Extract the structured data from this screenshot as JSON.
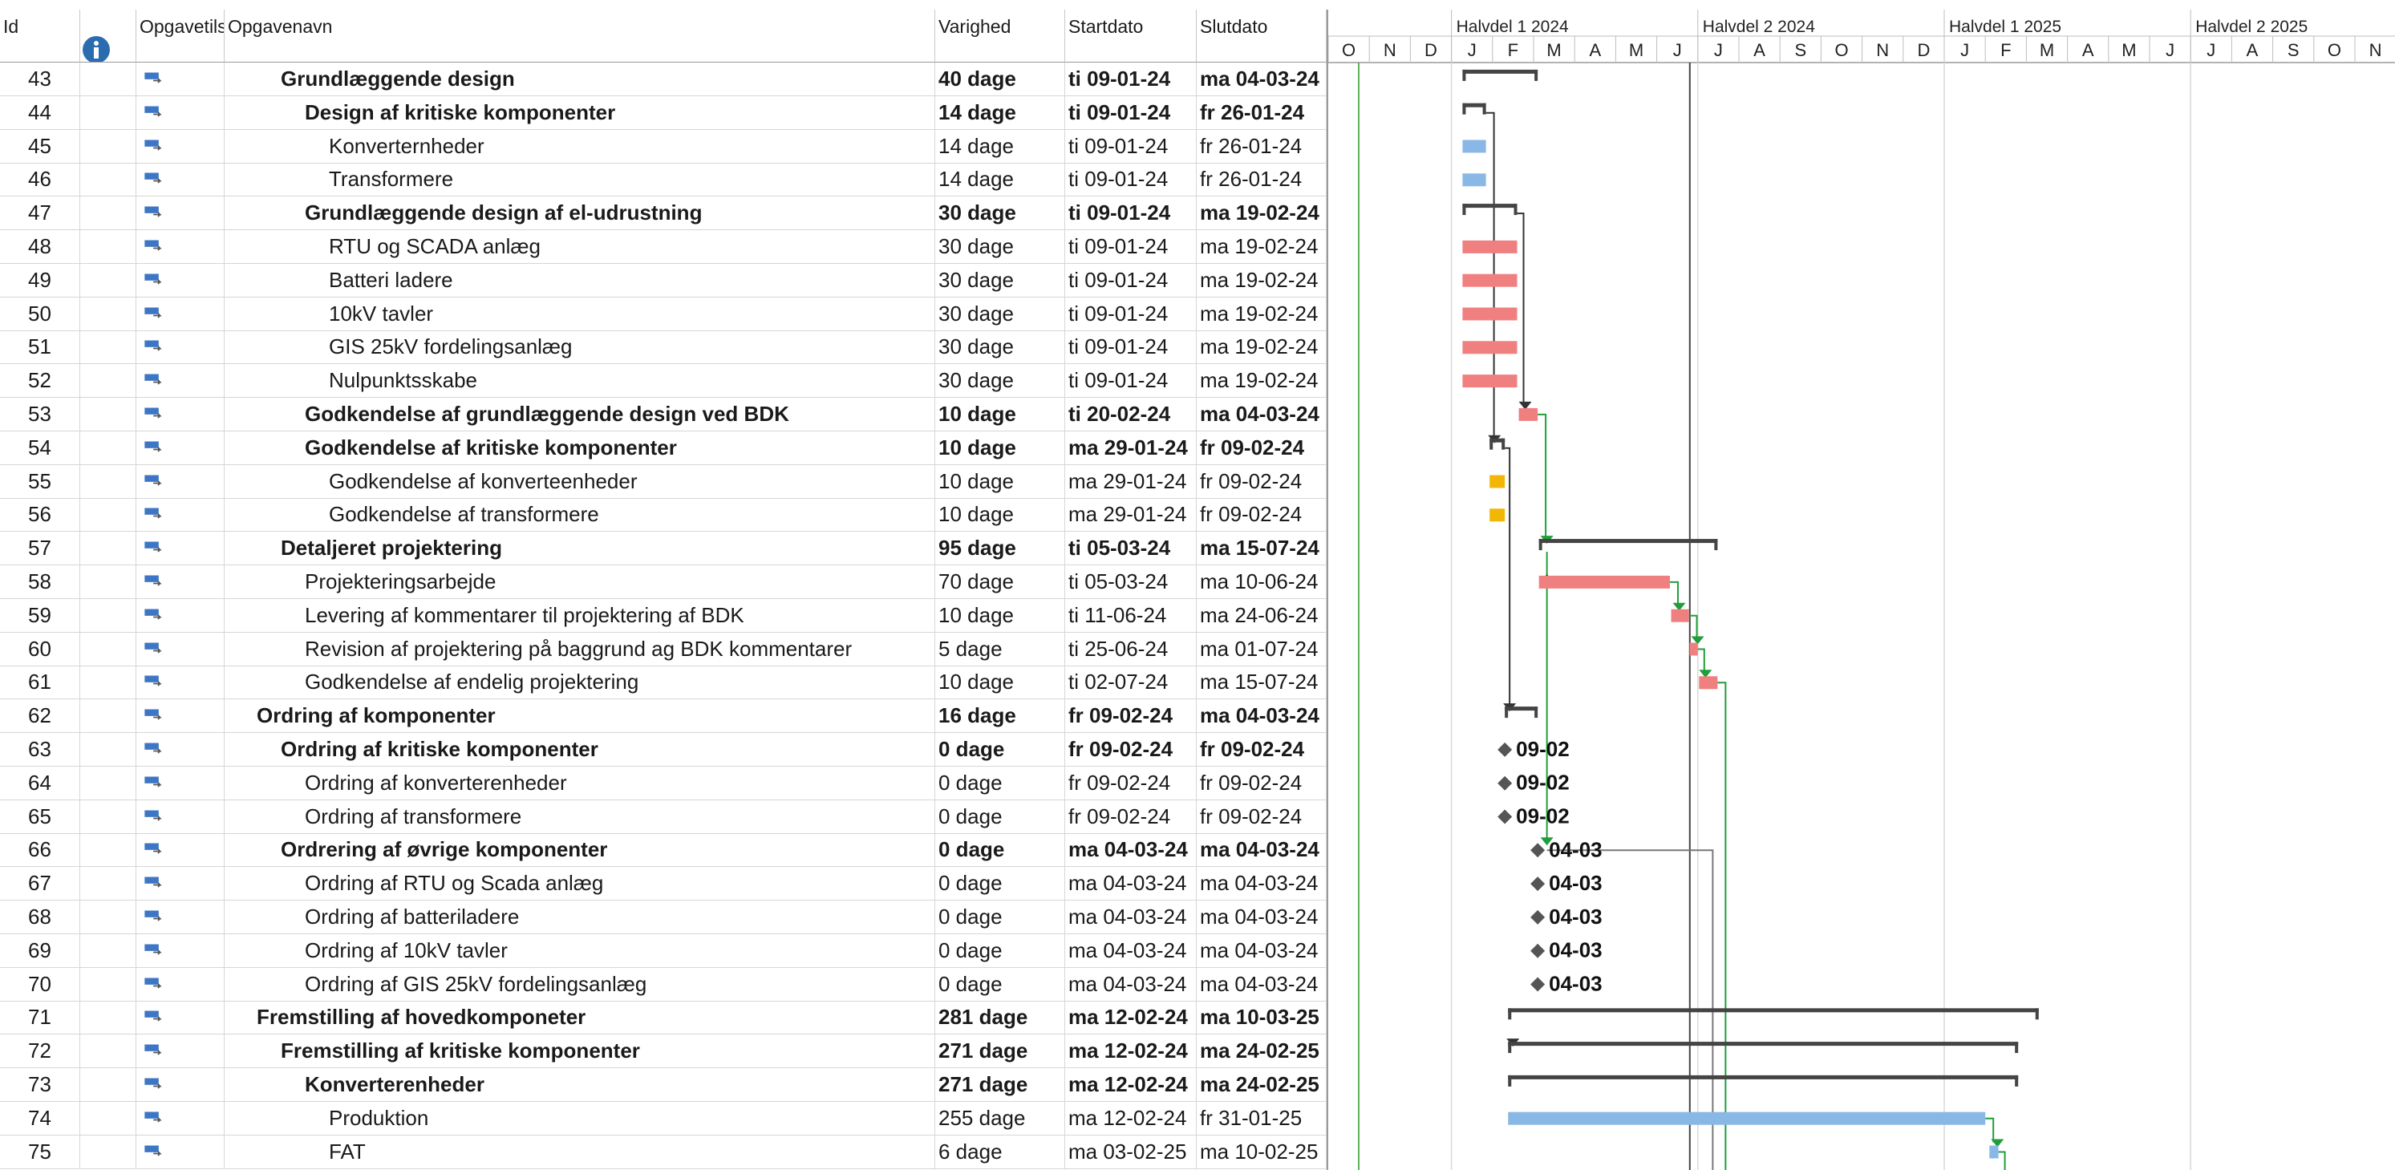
{
  "columns": {
    "id": "Id",
    "mode": "Opgavetils",
    "name": "Opgavenavn",
    "duration": "Varighed",
    "start": "Startdato",
    "finish": "Slutdato"
  },
  "icons": {
    "info": "info-icon",
    "task_mode": "auto-schedule-icon",
    "milestone": "diamond-icon"
  },
  "colors": {
    "summary_bar": "#444444",
    "bar_blue": "#8ab8e6",
    "bar_red": "#f08080",
    "bar_yellow": "#f2b705",
    "link_black": "#333333",
    "link_green": "#1f9e3a",
    "milestone": "#555555"
  },
  "timescale": {
    "periods": [
      "Halvdel 1 2024",
      "Halvdel 2 2024",
      "Halvdel 1 2025",
      "Halvdel 2 2025"
    ],
    "months": [
      "O",
      "N",
      "D",
      "J",
      "F",
      "M",
      "A",
      "M",
      "J",
      "J",
      "A",
      "S",
      "O",
      "N",
      "D",
      "J",
      "F",
      "M",
      "A",
      "M",
      "J",
      "J",
      "A",
      "S",
      "O",
      "N"
    ]
  },
  "rows": [
    {
      "id": "43",
      "name": "Grundlæggende design",
      "level": 2,
      "bold": true,
      "duration": "40 dage",
      "start": "ti 09-01-24",
      "finish": "ma 04-03-24",
      "bar": {
        "type": "summary",
        "s": 3.27,
        "e": 5.1
      }
    },
    {
      "id": "44",
      "name": "Design af kritiske komponenter",
      "level": 3,
      "bold": true,
      "duration": "14 dage",
      "start": "ti 09-01-24",
      "finish": "fr 26-01-24",
      "bar": {
        "type": "summary",
        "s": 3.27,
        "e": 3.84
      }
    },
    {
      "id": "45",
      "name": "Konverternheder",
      "level": 4,
      "bold": false,
      "duration": "14 dage",
      "start": "ti 09-01-24",
      "finish": "fr 26-01-24",
      "bar": {
        "type": "task",
        "color": "bar_blue",
        "s": 3.27,
        "e": 3.84
      }
    },
    {
      "id": "46",
      "name": "Transformere",
      "level": 4,
      "bold": false,
      "duration": "14 dage",
      "start": "ti 09-01-24",
      "finish": "fr 26-01-24",
      "bar": {
        "type": "task",
        "color": "bar_blue",
        "s": 3.27,
        "e": 3.84
      }
    },
    {
      "id": "47",
      "name": "Grundlæggende design af el-udrustning",
      "level": 3,
      "bold": true,
      "duration": "30 dage",
      "start": "ti 09-01-24",
      "finish": "ma 19-02-24",
      "bar": {
        "type": "summary",
        "s": 3.27,
        "e": 4.6
      }
    },
    {
      "id": "48",
      "name": "RTU og SCADA anlæg",
      "level": 4,
      "bold": false,
      "duration": "30 dage",
      "start": "ti 09-01-24",
      "finish": "ma 19-02-24",
      "bar": {
        "type": "task",
        "color": "bar_red",
        "s": 3.27,
        "e": 4.6
      }
    },
    {
      "id": "49",
      "name": "Batteri ladere",
      "level": 4,
      "bold": false,
      "duration": "30 dage",
      "start": "ti 09-01-24",
      "finish": "ma 19-02-24",
      "bar": {
        "type": "task",
        "color": "bar_red",
        "s": 3.27,
        "e": 4.6
      }
    },
    {
      "id": "50",
      "name": "10kV tavler",
      "level": 4,
      "bold": false,
      "duration": "30 dage",
      "start": "ti 09-01-24",
      "finish": "ma 19-02-24",
      "bar": {
        "type": "task",
        "color": "bar_red",
        "s": 3.27,
        "e": 4.6
      }
    },
    {
      "id": "51",
      "name": "GIS 25kV fordelingsanlæg",
      "level": 4,
      "bold": false,
      "duration": "30 dage",
      "start": "ti 09-01-24",
      "finish": "ma 19-02-24",
      "bar": {
        "type": "task",
        "color": "bar_red",
        "s": 3.27,
        "e": 4.6
      }
    },
    {
      "id": "52",
      "name": "Nulpunktsskabe",
      "level": 4,
      "bold": false,
      "duration": "30 dage",
      "start": "ti 09-01-24",
      "finish": "ma 19-02-24",
      "bar": {
        "type": "task",
        "color": "bar_red",
        "s": 3.27,
        "e": 4.6
      }
    },
    {
      "id": "53",
      "name": "Godkendelse af grundlæggende design ved BDK",
      "level": 3,
      "bold": true,
      "duration": "10 dage",
      "start": "ti 20-02-24",
      "finish": "ma 04-03-24",
      "bar": {
        "type": "task",
        "color": "bar_red",
        "s": 4.64,
        "e": 5.1
      }
    },
    {
      "id": "54",
      "name": "Godkendelse af kritiske komponenter",
      "level": 3,
      "bold": true,
      "duration": "10 dage",
      "start": "ma 29-01-24",
      "finish": "fr 09-02-24",
      "bar": {
        "type": "summary",
        "s": 3.93,
        "e": 4.3
      }
    },
    {
      "id": "55",
      "name": "Godkendelse af konverteenheder",
      "level": 4,
      "bold": false,
      "duration": "10 dage",
      "start": "ma 29-01-24",
      "finish": "fr 09-02-24",
      "bar": {
        "type": "task",
        "color": "bar_yellow",
        "s": 3.93,
        "e": 4.3
      }
    },
    {
      "id": "56",
      "name": "Godkendelse af transformere",
      "level": 4,
      "bold": false,
      "duration": "10 dage",
      "start": "ma 29-01-24",
      "finish": "fr 09-02-24",
      "bar": {
        "type": "task",
        "color": "bar_yellow",
        "s": 3.93,
        "e": 4.3
      }
    },
    {
      "id": "57",
      "name": "Detaljeret projektering",
      "level": 2,
      "bold": true,
      "duration": "95 dage",
      "start": "ti 05-03-24",
      "finish": "ma 15-07-24",
      "bar": {
        "type": "summary",
        "s": 5.13,
        "e": 9.48
      }
    },
    {
      "id": "58",
      "name": "Projekteringsarbejde",
      "level": 3,
      "bold": false,
      "duration": "70 dage",
      "start": "ti 05-03-24",
      "finish": "ma 10-06-24",
      "bar": {
        "type": "task",
        "color": "bar_red",
        "s": 5.13,
        "e": 8.32
      }
    },
    {
      "id": "59",
      "name": "Levering af kommentarer til projektering af BDK",
      "level": 3,
      "bold": false,
      "duration": "10 dage",
      "start": "ti 11-06-24",
      "finish": "ma 24-06-24",
      "bar": {
        "type": "task",
        "color": "bar_red",
        "s": 8.35,
        "e": 8.78
      }
    },
    {
      "id": "60",
      "name": "Revision af projektering på baggrund ag BDK kommentarer",
      "level": 3,
      "bold": false,
      "duration": "5 dage",
      "start": "ti 25-06-24",
      "finish": "ma 01-07-24",
      "bar": {
        "type": "task",
        "color": "bar_red",
        "s": 8.8,
        "e": 9.0
      }
    },
    {
      "id": "61",
      "name": "Godkendelse af endelig projektering",
      "level": 3,
      "bold": false,
      "duration": "10 dage",
      "start": "ti 02-07-24",
      "finish": "ma 15-07-24",
      "bar": {
        "type": "task",
        "color": "bar_red",
        "s": 9.03,
        "e": 9.48
      }
    },
    {
      "id": "62",
      "name": "Ordring af komponenter",
      "level": 1,
      "bold": true,
      "duration": "16 dage",
      "start": "fr 09-02-24",
      "finish": "ma 04-03-24",
      "bar": {
        "type": "summary",
        "s": 4.3,
        "e": 5.1
      }
    },
    {
      "id": "63",
      "name": "Ordring af kritiske komponenter",
      "level": 2,
      "bold": true,
      "duration": "0 dage",
      "start": "fr 09-02-24",
      "finish": "fr 09-02-24",
      "bar": {
        "type": "milestone",
        "s": 4.3,
        "label": "09-02"
      }
    },
    {
      "id": "64",
      "name": "Ordring af konverterenheder",
      "level": 3,
      "bold": false,
      "duration": "0 dage",
      "start": "fr 09-02-24",
      "finish": "fr 09-02-24",
      "bar": {
        "type": "milestone",
        "s": 4.3,
        "label": "09-02"
      }
    },
    {
      "id": "65",
      "name": "Ordring af transformere",
      "level": 3,
      "bold": false,
      "duration": "0 dage",
      "start": "fr 09-02-24",
      "finish": "fr 09-02-24",
      "bar": {
        "type": "milestone",
        "s": 4.3,
        "label": "09-02"
      }
    },
    {
      "id": "66",
      "name": "Ordrering af øvrige komponenter",
      "level": 2,
      "bold": true,
      "duration": "0 dage",
      "start": "ma 04-03-24",
      "finish": "ma 04-03-24",
      "bar": {
        "type": "milestone",
        "s": 5.1,
        "label": "04-03"
      }
    },
    {
      "id": "67",
      "name": "Ordring af RTU og Scada anlæg",
      "level": 3,
      "bold": false,
      "duration": "0 dage",
      "start": "ma 04-03-24",
      "finish": "ma 04-03-24",
      "bar": {
        "type": "milestone",
        "s": 5.1,
        "label": "04-03"
      }
    },
    {
      "id": "68",
      "name": "Ordring af batteriladere",
      "level": 3,
      "bold": false,
      "duration": "0 dage",
      "start": "ma 04-03-24",
      "finish": "ma 04-03-24",
      "bar": {
        "type": "milestone",
        "s": 5.1,
        "label": "04-03"
      }
    },
    {
      "id": "69",
      "name": "Ordring af 10kV tavler",
      "level": 3,
      "bold": false,
      "duration": "0 dage",
      "start": "ma 04-03-24",
      "finish": "ma 04-03-24",
      "bar": {
        "type": "milestone",
        "s": 5.1,
        "label": "04-03"
      }
    },
    {
      "id": "70",
      "name": "Ordring af GIS 25kV fordelingsanlæg",
      "level": 3,
      "bold": false,
      "duration": "0 dage",
      "start": "ma 04-03-24",
      "finish": "ma 04-03-24",
      "bar": {
        "type": "milestone",
        "s": 5.1,
        "label": "04-03"
      }
    },
    {
      "id": "71",
      "name": "Fremstilling af hovedkomponeter",
      "level": 1,
      "bold": true,
      "duration": "281 dage",
      "start": "ma 12-02-24",
      "finish": "ma 10-03-25",
      "bar": {
        "type": "summary",
        "s": 4.38,
        "e": 17.3
      }
    },
    {
      "id": "72",
      "name": "Fremstilling af kritiske komponenter",
      "level": 2,
      "bold": true,
      "duration": "271 dage",
      "start": "ma 12-02-24",
      "finish": "ma 24-02-25",
      "bar": {
        "type": "summary",
        "s": 4.38,
        "e": 16.8
      }
    },
    {
      "id": "73",
      "name": "Konverterenheder",
      "level": 3,
      "bold": true,
      "duration": "271 dage",
      "start": "ma 12-02-24",
      "finish": "ma 24-02-25",
      "bar": {
        "type": "summary",
        "s": 4.38,
        "e": 16.8
      }
    },
    {
      "id": "74",
      "name": "Produktion",
      "level": 4,
      "bold": false,
      "duration": "255 dage",
      "start": "ma 12-02-24",
      "finish": "fr 31-01-25",
      "bar": {
        "type": "task",
        "color": "bar_blue",
        "s": 4.38,
        "e": 16.0
      }
    },
    {
      "id": "75",
      "name": "FAT",
      "level": 4,
      "bold": false,
      "duration": "6 dage",
      "start": "ma 03-02-25",
      "finish": "ma 10-02-25",
      "bar": {
        "type": "task",
        "color": "bar_blue",
        "s": 16.1,
        "e": 16.32
      }
    }
  ]
}
